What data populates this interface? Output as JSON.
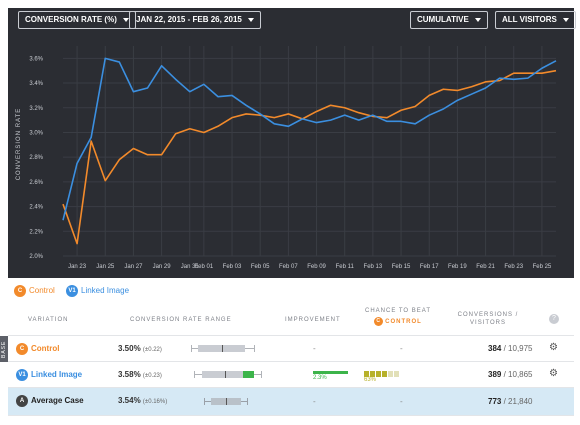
{
  "toolbar": {
    "metric": "CONVERSION RATE (%)",
    "date_range": "JAN 22, 2015 - FEB 26, 2015",
    "mode": "CUMULATIVE",
    "segment": "ALL VISITORS"
  },
  "colors": {
    "control": "#f28a2b",
    "variant": "#3b8fe0",
    "background": "#2b2d33",
    "improvement": "#3cb44a",
    "chance": "#b7b12a",
    "average_row": "#d6e9f5"
  },
  "chart_data": {
    "type": "line",
    "ylabel": "CONVERSION RATE",
    "ylim": [
      2.0,
      3.7
    ],
    "yticks": [
      "3.6%",
      "3.4%",
      "3.2%",
      "3.0%",
      "2.8%",
      "2.6%",
      "2.4%",
      "2.2%",
      "2.0%"
    ],
    "ytick_values": [
      3.6,
      3.4,
      3.2,
      3.0,
      2.8,
      2.6,
      2.4,
      2.2,
      2.0
    ],
    "xticks": [
      "Jan 23",
      "Jan 25",
      "Jan 27",
      "Jan 29",
      "Jan 31",
      "Feb 01",
      "Feb 03",
      "Feb 05",
      "Feb 07",
      "Feb 09",
      "Feb 11",
      "Feb 13",
      "Feb 15",
      "Feb 17",
      "Feb 19",
      "Feb 21",
      "Feb 23",
      "Feb 25"
    ],
    "xtick_days": [
      1,
      3,
      5,
      7,
      9,
      10,
      12,
      14,
      16,
      18,
      20,
      22,
      24,
      26,
      28,
      30,
      32,
      34
    ],
    "grid": true,
    "series": [
      {
        "name": "Control",
        "x": [
          0,
          1,
          2,
          3,
          4,
          5,
          6,
          7,
          8,
          9,
          10,
          11,
          12,
          13,
          14,
          15,
          16,
          17,
          18,
          19,
          20,
          21,
          22,
          23,
          24,
          25,
          26,
          27,
          28,
          29,
          30,
          31,
          32,
          33,
          34,
          35
        ],
        "values": [
          2.42,
          2.1,
          2.93,
          2.61,
          2.78,
          2.87,
          2.82,
          2.82,
          2.99,
          3.03,
          3.0,
          3.05,
          3.12,
          3.15,
          3.14,
          3.12,
          3.15,
          3.11,
          3.17,
          3.22,
          3.2,
          3.16,
          3.13,
          3.12,
          3.18,
          3.21,
          3.3,
          3.35,
          3.34,
          3.37,
          3.41,
          3.42,
          3.48,
          3.48,
          3.48,
          3.5
        ]
      },
      {
        "name": "Linked Image",
        "x": [
          0,
          1,
          2,
          3,
          4,
          5,
          6,
          7,
          8,
          9,
          10,
          11,
          12,
          13,
          14,
          15,
          16,
          17,
          18,
          19,
          20,
          21,
          22,
          23,
          24,
          25,
          26,
          27,
          28,
          29,
          30,
          31,
          32,
          33,
          34,
          35
        ],
        "values": [
          2.29,
          2.75,
          2.96,
          3.6,
          3.57,
          3.33,
          3.36,
          3.54,
          3.43,
          3.33,
          3.39,
          3.29,
          3.3,
          3.22,
          3.15,
          3.07,
          3.05,
          3.11,
          3.08,
          3.1,
          3.14,
          3.1,
          3.14,
          3.09,
          3.09,
          3.07,
          3.14,
          3.19,
          3.26,
          3.31,
          3.36,
          3.44,
          3.43,
          3.44,
          3.52,
          3.58
        ]
      }
    ]
  },
  "legend": {
    "control_label": "Control",
    "control_badge": "C",
    "variant_label": "Linked Image",
    "variant_badge": "V1"
  },
  "table": {
    "headers": {
      "variation": "VARIATION",
      "range": "CONVERSION RATE RANGE",
      "improvement": "IMPROVEMENT",
      "chance": "CHANCE TO BEAT",
      "chance_target": "CONTROL",
      "conversions": "CONVERSIONS /",
      "visitors": "VISITORS",
      "help": "?"
    },
    "base_tag": "BASE",
    "rows": [
      {
        "badge": "C",
        "name": "Control",
        "rate": "3.50%",
        "interval": "(±0.22)",
        "improvement": "-",
        "chance": "-",
        "conversions": "384",
        "visitors": "/ 10,975"
      },
      {
        "badge": "V1",
        "name": "Linked Image",
        "rate": "3.58%",
        "interval": "(±0.23)",
        "improvement": "2.3%",
        "improvement_fraction": 0.023,
        "chance": "63%",
        "chance_fraction": 0.63,
        "conversions": "389",
        "visitors": "/ 10,865"
      },
      {
        "badge": "A",
        "name": "Average Case",
        "rate": "3.54%",
        "interval": "(±0.16%)",
        "improvement": "-",
        "chance": "-",
        "conversions": "773",
        "visitors": "/ 21,840"
      }
    ]
  },
  "icons": {
    "caret": "chevron-down-icon",
    "gear": "gear-icon"
  }
}
